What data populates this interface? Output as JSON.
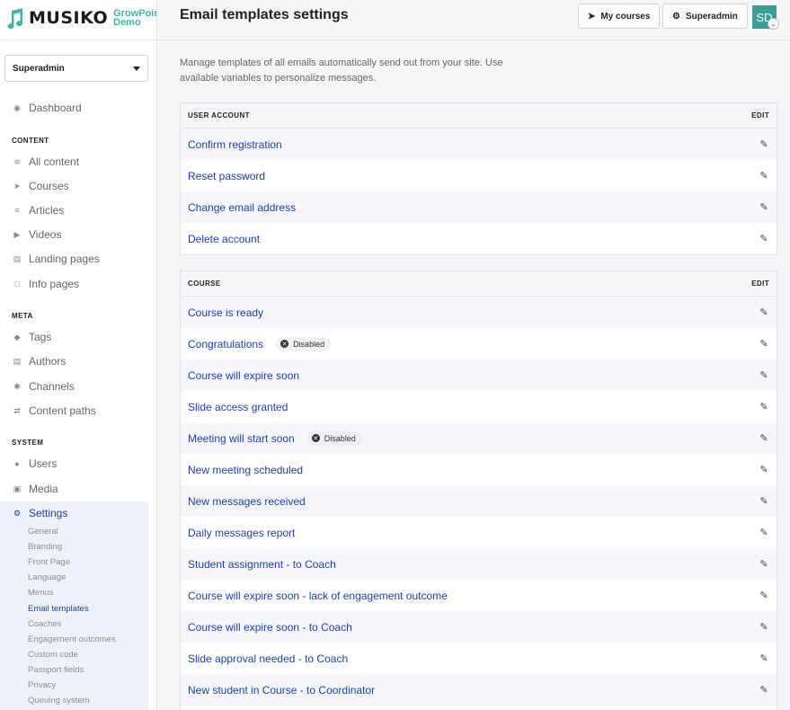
{
  "app": {
    "logo_text": "MUSIKO",
    "logo_sub_1": "GrowPoint",
    "logo_sub_2": "Demo",
    "role": "Superadmin",
    "accent": "#1c3fb7",
    "brand": "#3fb5a8"
  },
  "sidebar": {
    "dashboard": "Dashboard",
    "sections": {
      "content": "CONTENT",
      "meta": "META",
      "system": "SYSTEM"
    },
    "content_items": [
      {
        "label": "All content",
        "icon": "rss-icon"
      },
      {
        "label": "Courses",
        "icon": "rocket-icon"
      },
      {
        "label": "Articles",
        "icon": "lines-icon"
      },
      {
        "label": "Videos",
        "icon": "play-icon"
      },
      {
        "label": "Landing pages",
        "icon": "newspaper-icon"
      },
      {
        "label": "Info pages",
        "icon": "file-icon"
      }
    ],
    "meta_items": [
      {
        "label": "Tags",
        "icon": "tag-icon"
      },
      {
        "label": "Authors",
        "icon": "id-card-icon"
      },
      {
        "label": "Channels",
        "icon": "asterisk-icon"
      },
      {
        "label": "Content paths",
        "icon": "shuffle-icon"
      }
    ],
    "system_items": [
      {
        "label": "Users",
        "icon": "user-icon"
      },
      {
        "label": "Media",
        "icon": "image-icon"
      },
      {
        "label": "Settings",
        "icon": "gear-icon"
      }
    ],
    "settings_sub": [
      "General",
      "Branding",
      "Front Page",
      "Language",
      "Menus",
      "Email templates",
      "Coaches",
      "Engagement outcomes",
      "Custom code",
      "Passport fields",
      "Privacy",
      "Queuing system"
    ]
  },
  "topbar": {
    "title": "Email templates settings",
    "my_courses": "My courses",
    "superadmin": "Superadmin",
    "avatar": "SD"
  },
  "main": {
    "intro": "Manage templates of all emails automatically send out from your site. Use available variables to personalize messages.",
    "user_account": {
      "header": "USER ACCOUNT",
      "edit": "EDIT",
      "rows": [
        "Confirm registration",
        "Reset password",
        "Change email address",
        "Delete account"
      ]
    },
    "course": {
      "header": "COURSE",
      "edit": "EDIT",
      "disabled_label": "Disabled",
      "rows": [
        "Course is ready",
        "Congratulations",
        "Course will expire soon",
        "Slide access granted",
        "Meeting will start soon",
        "New meeting scheduled",
        "New messages received",
        "Daily messages report",
        "Student assignment - to Coach",
        "Course will expire soon - lack of engagement outcome",
        "Course will expire soon - to Coach",
        "Slide approval needed - to Coach",
        "New student in Course - to Coordinator"
      ]
    }
  }
}
